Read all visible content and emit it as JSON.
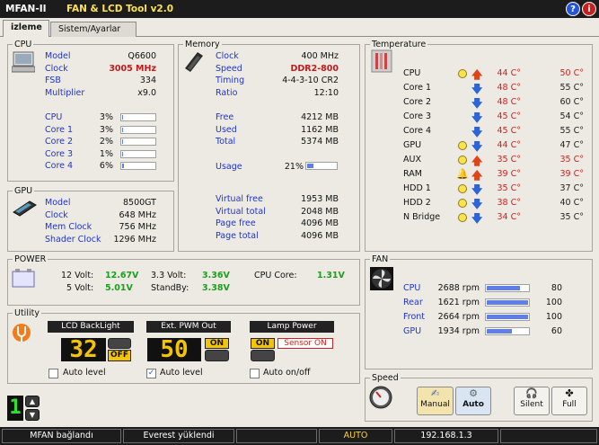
{
  "app": {
    "name": "MFAN-II",
    "tool": "FAN & LCD Tool v2.0",
    "help_icon": "?",
    "info_icon": "i"
  },
  "tabs": [
    {
      "label": "izleme"
    },
    {
      "label": "Sistem/Ayarlar"
    }
  ],
  "cpu": {
    "legend": "CPU",
    "specs": [
      {
        "label": "Model",
        "value": "Q6600"
      },
      {
        "label": "Clock",
        "value": "3005 MHz"
      },
      {
        "label": "FSB",
        "value": "334"
      },
      {
        "label": "Multiplier",
        "value": "x9.0"
      }
    ],
    "loads": [
      {
        "label": "CPU",
        "value": "3%",
        "pct": 3
      },
      {
        "label": "Core 1",
        "value": "3%",
        "pct": 3
      },
      {
        "label": "Core 2",
        "value": "2%",
        "pct": 2
      },
      {
        "label": "Core 3",
        "value": "1%",
        "pct": 1
      },
      {
        "label": "Core 4",
        "value": "6%",
        "pct": 6
      }
    ]
  },
  "gpu": {
    "legend": "GPU",
    "specs": [
      {
        "label": "Model",
        "value": "8500GT"
      },
      {
        "label": "Clock",
        "value": "648 MHz"
      },
      {
        "label": "Mem Clock",
        "value": "756 MHz"
      },
      {
        "label": "Shader Clock",
        "value": "1296 MHz"
      }
    ]
  },
  "memory": {
    "legend": "Memory",
    "specs": [
      {
        "label": "Clock",
        "value": "400 MHz"
      },
      {
        "label": "Speed",
        "value": "DDR2-800"
      },
      {
        "label": "Timing",
        "value": "4-4-3-10 CR2"
      },
      {
        "label": "Ratio",
        "value": "12:10"
      }
    ],
    "usage_rows": [
      {
        "label": "Free",
        "value": "4212 MB"
      },
      {
        "label": "Used",
        "value": "1162 MB"
      },
      {
        "label": "Total",
        "value": "5374 MB"
      }
    ],
    "usage": {
      "label": "Usage",
      "value": "21%",
      "pct": 21
    },
    "virtual": [
      {
        "label": "Virtual free",
        "value": "1953 MB"
      },
      {
        "label": "Virtual total",
        "value": "2048 MB"
      },
      {
        "label": "Page free",
        "value": "4096 MB"
      },
      {
        "label": "Page total",
        "value": "4096 MB"
      }
    ]
  },
  "temperature": {
    "legend": "Temperature",
    "rows": [
      {
        "label": "CPU",
        "dot": true,
        "bell": false,
        "dir": "up",
        "current": "44 C°",
        "max": "50 C°"
      },
      {
        "label": "Core 1",
        "dot": false,
        "bell": false,
        "dir": "down",
        "current": "48 C°",
        "max": "55 C°"
      },
      {
        "label": "Core 2",
        "dot": false,
        "bell": false,
        "dir": "down",
        "current": "48 C°",
        "max": "60 C°"
      },
      {
        "label": "Core 3",
        "dot": false,
        "bell": false,
        "dir": "down",
        "current": "45 C°",
        "max": "54 C°"
      },
      {
        "label": "Core 4",
        "dot": false,
        "bell": false,
        "dir": "down",
        "current": "45 C°",
        "max": "55 C°"
      },
      {
        "label": "GPU",
        "dot": true,
        "bell": false,
        "dir": "down",
        "current": "44 C°",
        "max": "47 C°"
      },
      {
        "label": "AUX",
        "dot": true,
        "bell": false,
        "dir": "up",
        "current": "35 C°",
        "max": "35 C°"
      },
      {
        "label": "RAM",
        "dot": false,
        "bell": true,
        "dir": "up",
        "current": "39 C°",
        "max": "39 C°"
      },
      {
        "label": "HDD 1",
        "dot": true,
        "bell": false,
        "dir": "down",
        "current": "35 C°",
        "max": "37 C°"
      },
      {
        "label": "HDD 2",
        "dot": true,
        "bell": false,
        "dir": "down",
        "current": "38 C°",
        "max": "40 C°"
      },
      {
        "label": "N Bridge",
        "dot": true,
        "bell": false,
        "dir": "down",
        "current": "34 C°",
        "max": "35 C°"
      }
    ]
  },
  "power": {
    "legend": "POWER",
    "items": [
      {
        "label": "12 Volt:",
        "value": "12.67V"
      },
      {
        "label": "3.3 Volt:",
        "value": "3.36V"
      },
      {
        "label": "CPU Core:",
        "value": "1.31V"
      },
      {
        "label": "5 Volt:",
        "value": "5.01V"
      },
      {
        "label": "StandBy:",
        "value": "3.38V"
      }
    ]
  },
  "fan": {
    "legend": "FAN",
    "rows": [
      {
        "label": "CPU",
        "rpm": "2688 rpm",
        "pct": 80,
        "pct_text": "80"
      },
      {
        "label": "Rear",
        "rpm": "1621 rpm",
        "pct": 100,
        "pct_text": "100"
      },
      {
        "label": "Front",
        "rpm": "2664 rpm",
        "pct": 100,
        "pct_text": "100"
      },
      {
        "label": "GPU",
        "rpm": "1934 rpm",
        "pct": 60,
        "pct_text": "60"
      }
    ]
  },
  "utility": {
    "legend": "Utility",
    "lcd": {
      "title": "LCD BackLight",
      "value": "32",
      "toggle": "OFF",
      "check_label": "Auto level",
      "checked": false
    },
    "pwm": {
      "title": "Ext. PWM Out",
      "value": "50",
      "toggle": "ON",
      "check_label": "Auto level",
      "checked": true
    },
    "lamp": {
      "title": "Lamp Power",
      "toggle": "ON",
      "sensor": "Sensor ON",
      "check_label": "Auto on/off",
      "checked": false
    }
  },
  "speed": {
    "legend": "Speed",
    "buttons": [
      {
        "label": "Manual"
      },
      {
        "label": "Auto"
      },
      {
        "label": "Silent"
      },
      {
        "label": "Full"
      }
    ]
  },
  "profile": {
    "value": "1"
  },
  "status": [
    {
      "text": "MFAN bağlandı"
    },
    {
      "text": "Everest yüklendi"
    },
    {
      "text": ""
    },
    {
      "text": "AUTO"
    },
    {
      "text": "192.168.1.3"
    },
    {
      "text": ""
    }
  ]
}
